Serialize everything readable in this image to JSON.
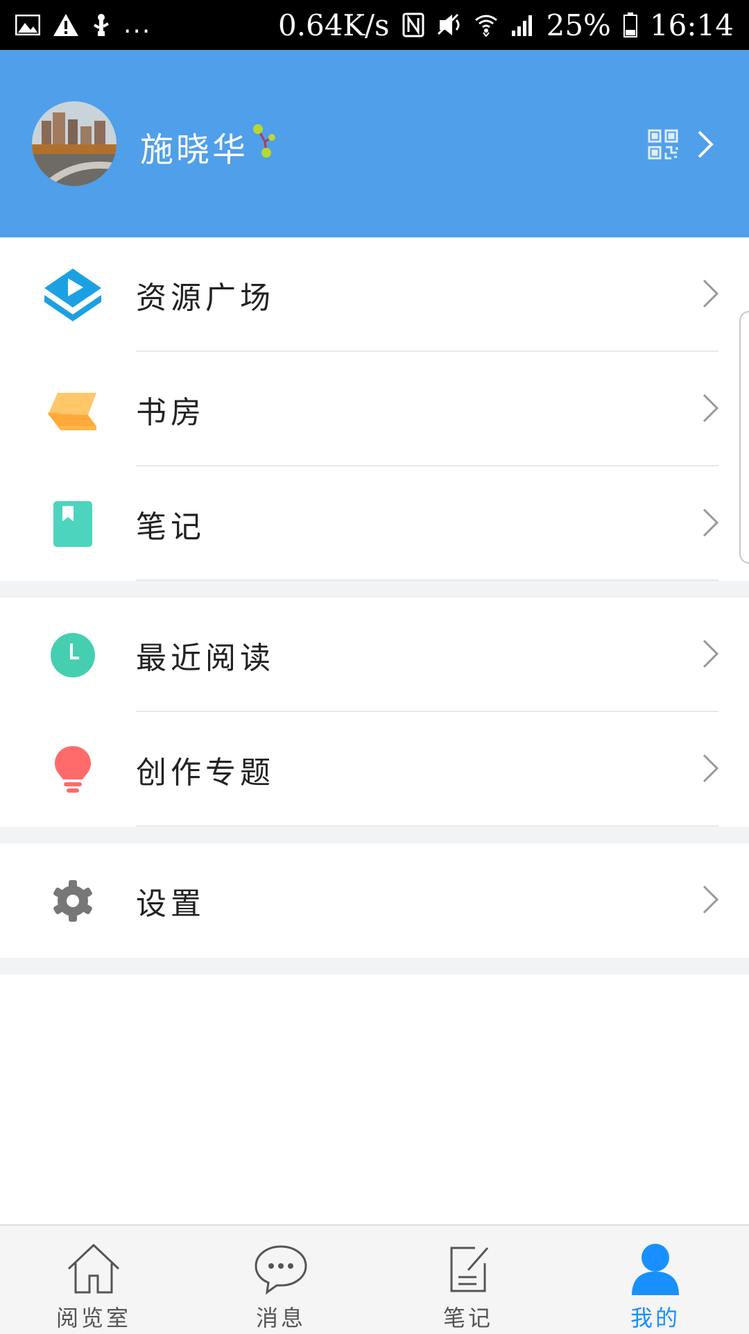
{
  "status_bar": {
    "network_speed": "0.64K/s",
    "battery": "25%",
    "time": "16:14",
    "left_icons": [
      "image-icon",
      "warning-icon",
      "usb-debug-icon"
    ],
    "ellipsis": "...",
    "right_icons": [
      "nfc-icon",
      "vibrate-icon",
      "wifi-icon",
      "signal-icon",
      "battery-icon"
    ]
  },
  "header": {
    "username": "施晓华",
    "background_color": "#4f9fea",
    "qr_icon": "qr-code-icon",
    "chevron_icon": "chevron-right-icon"
  },
  "menu": {
    "group1": [
      {
        "label": "资源广场",
        "icon": "resource-square-icon",
        "color": "#1ba1e2"
      },
      {
        "label": "书房",
        "icon": "study-room-icon",
        "color": "#ffb84d"
      },
      {
        "label": "笔记",
        "icon": "notebook-icon",
        "color": "#4dd4be"
      }
    ],
    "group2": [
      {
        "label": "最近阅读",
        "icon": "clock-icon",
        "color": "#45cfb0"
      },
      {
        "label": "创作专题",
        "icon": "lightbulb-icon",
        "color": "#ff6b6b"
      }
    ],
    "group3": [
      {
        "label": "设置",
        "icon": "gear-icon",
        "color": "#777777"
      }
    ]
  },
  "bottom_nav": {
    "tabs": [
      {
        "label": "阅览室",
        "icon": "home-icon",
        "active": false
      },
      {
        "label": "消息",
        "icon": "message-icon",
        "active": false
      },
      {
        "label": "笔记",
        "icon": "note-icon",
        "active": false
      },
      {
        "label": "我的",
        "icon": "person-icon",
        "active": true
      }
    ],
    "active_color": "#1890ff"
  }
}
